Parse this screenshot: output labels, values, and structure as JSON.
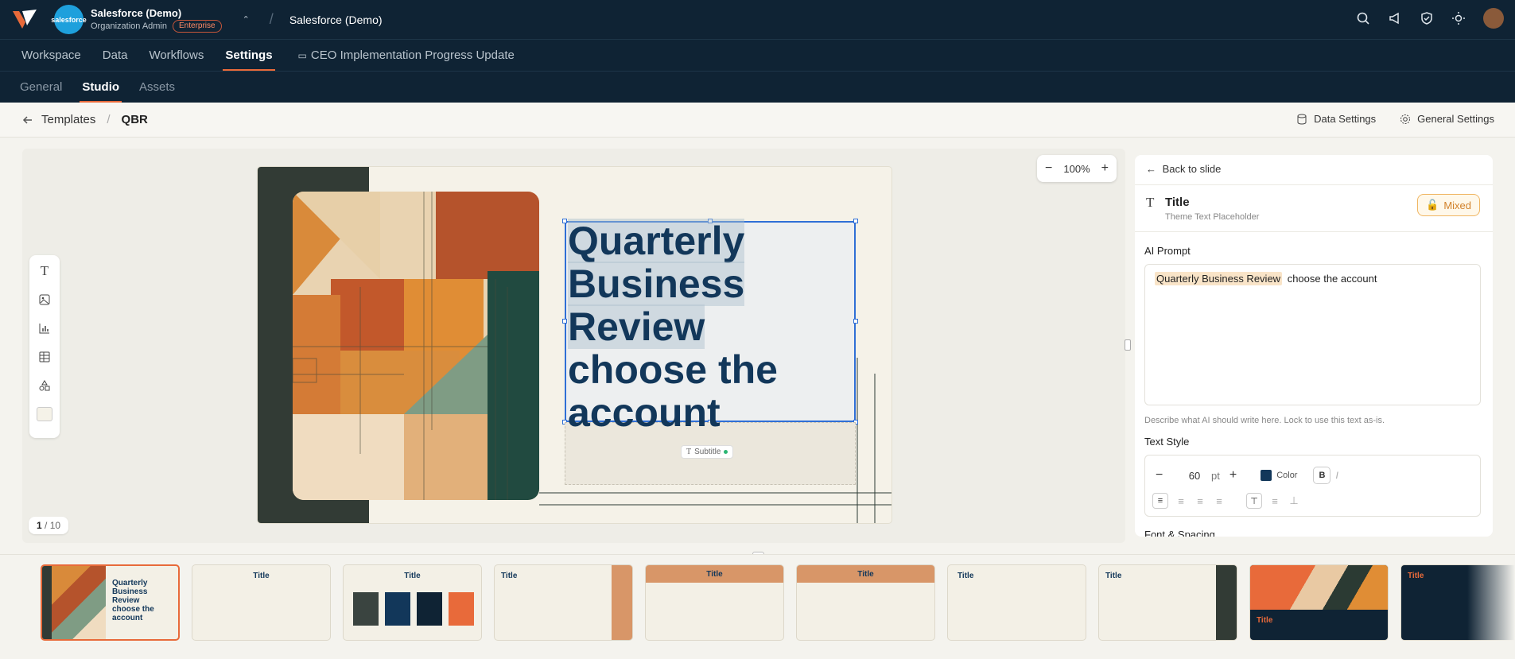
{
  "topbar": {
    "org_name": "Salesforce (Demo)",
    "org_role": "Organization Admin",
    "plan_badge": "Enterprise",
    "org_logo_text": "salesforce",
    "workspace_crumb": "Salesforce (Demo)"
  },
  "nav_primary": {
    "tabs": [
      "Workspace",
      "Data",
      "Workflows",
      "Settings"
    ],
    "active": "Settings",
    "document_tab": "CEO Implementation Progress Update"
  },
  "nav_secondary": {
    "tabs": [
      "General",
      "Studio",
      "Assets"
    ],
    "active": "Studio"
  },
  "breadcrumb": {
    "parent": "Templates",
    "current": "QBR",
    "data_settings": "Data Settings",
    "general_settings": "General Settings"
  },
  "canvas": {
    "zoom": "100%",
    "page_current": "1",
    "page_total": "/ 10",
    "slide_title_lines": [
      "Quarterly",
      "Business",
      "Review",
      "choose the",
      "account"
    ],
    "subtitle_chip": "Subtitle"
  },
  "panel": {
    "back": "Back to slide",
    "element_title": "Title",
    "element_subtitle": "Theme Text Placeholder",
    "lock_state": "Mixed",
    "ai_prompt_label": "AI Prompt",
    "ai_prompt_highlight": "Quarterly Business Review",
    "ai_prompt_rest": "choose the account",
    "ai_help": "Describe what AI should write here. Lock to use this text as-is.",
    "text_style_label": "Text Style",
    "font_size": "60",
    "font_unit": "pt",
    "color_label": "Color",
    "color_value": "#12375a",
    "font_spacing_label": "Font & Spacing"
  },
  "thumbnails": [
    {
      "title": "Quarterly Business Review choose the account",
      "selected": true
    },
    {
      "title": "Title"
    },
    {
      "title": "Title"
    },
    {
      "title": "Title"
    },
    {
      "title": "Title"
    },
    {
      "title": "Title"
    },
    {
      "title": "Title"
    },
    {
      "title": "Title"
    },
    {
      "title": "Title"
    },
    {
      "title": "Title"
    }
  ],
  "colors": {
    "brand_dark": "#0f2334",
    "accent": "#e86a3a",
    "selection": "#2f6fd6"
  }
}
